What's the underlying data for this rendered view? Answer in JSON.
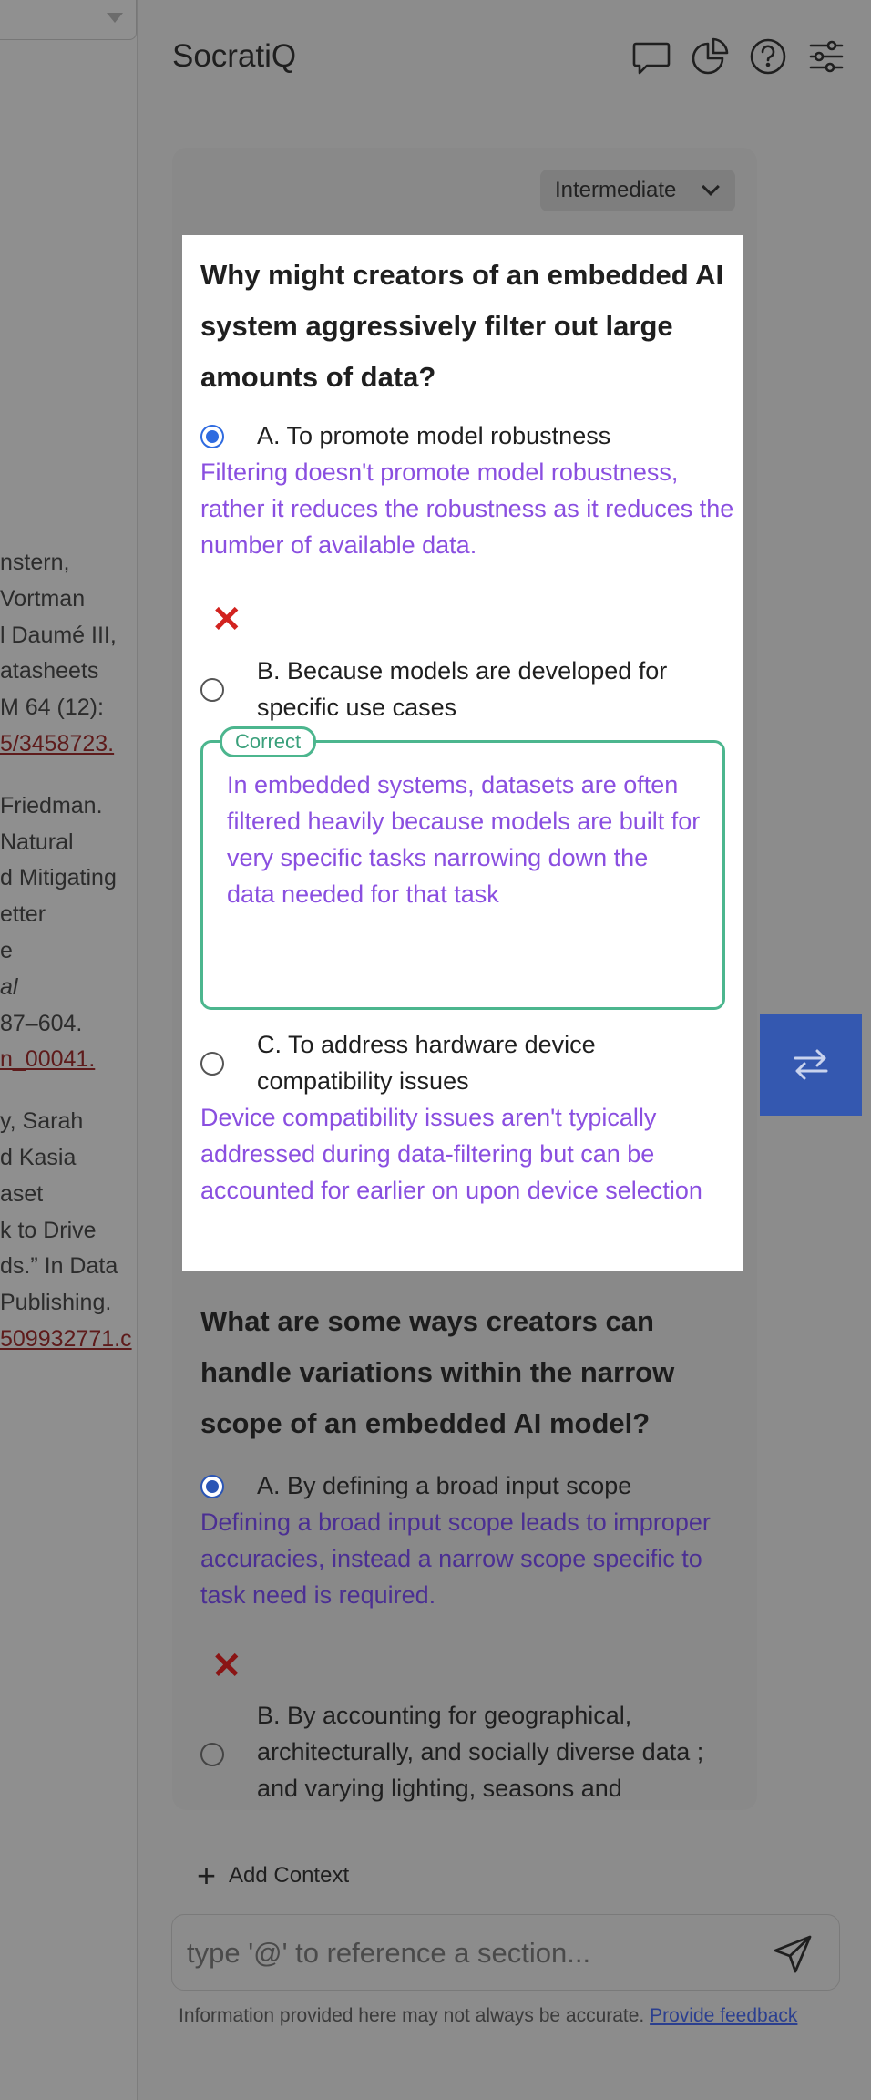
{
  "doc": {
    "lines": [
      {
        "t": "nstern,"
      },
      {
        "t": "Vortman"
      },
      {
        "t": "l Daumé III,"
      },
      {
        "t": "atasheets"
      },
      {
        "t": "M 64 (12):"
      },
      {
        "t": "5/3458723.",
        "link": true
      },
      {
        "t": "",
        "gap": true
      },
      {
        "t": "Friedman."
      },
      {
        "t": "Natural"
      },
      {
        "t": "d Mitigating"
      },
      {
        "t": "etter"
      },
      {
        "t": "e"
      },
      {
        "t": "al",
        "italic": true
      },
      {
        "t": "87–604."
      },
      {
        "t": "n_00041.",
        "link": true
      },
      {
        "t": "",
        "gap": true
      },
      {
        "t": "y, Sarah"
      },
      {
        "t": "d Kasia"
      },
      {
        "t": "aset"
      },
      {
        "t": "k to Drive"
      },
      {
        "t": "ds.” In Data"
      },
      {
        "t": " Publishing."
      },
      {
        "t": "509932771.c",
        "link": true
      }
    ]
  },
  "app": {
    "title": "SocratiQ"
  },
  "header_icons": [
    "chat-icon",
    "chart-icon",
    "help-icon",
    "settings-sliders-icon"
  ],
  "difficulty": {
    "selected": "Intermediate"
  },
  "question1": {
    "text": "Why might creators of an embedded AI system aggressively filter out large amounts of data?",
    "options": [
      {
        "label": "A. To promote model robustness",
        "checked": true,
        "feedback": "Filtering doesn't promote model robustness, rather it reduces the robustness as it reduces the number of available data."
      },
      {
        "label": "B. Because models are developed for specific use cases",
        "checked": false,
        "correct_tag": "Correct",
        "feedback": "In embedded systems, datasets are often filtered heavily because models are built for very specific tasks narrowing down the data needed for that task"
      },
      {
        "label": "C. To address hardware device compatibility issues",
        "checked": false,
        "feedback": "Device compatibility issues aren't typically addressed during data-filtering but can be accounted for earlier on upon device selection"
      }
    ]
  },
  "question2": {
    "text": "What are some ways creators can handle variations within the narrow scope of an embedded AI model?",
    "options": [
      {
        "label": "A. By defining a broad input scope",
        "checked": true,
        "feedback": "Defining a broad input scope leads to improper accuracies, instead a narrow scope specific to task need is required."
      },
      {
        "label": "B. By accounting for geographical, architecturally, and socially diverse data ; and varying lighting, seasons and",
        "checked": false
      }
    ]
  },
  "bottom": {
    "add_context": "Add Context",
    "input_placeholder": "type '@' to reference a section...",
    "disclaimer": "Information provided here may not always be accurate.",
    "feedback_link": "Provide feedback"
  },
  "colors": {
    "accent": "#2f6be0",
    "correct": "#4cb68e",
    "feedback": "#8a4fe0",
    "wrong": "#d2231f",
    "fab": "#3458b0"
  }
}
